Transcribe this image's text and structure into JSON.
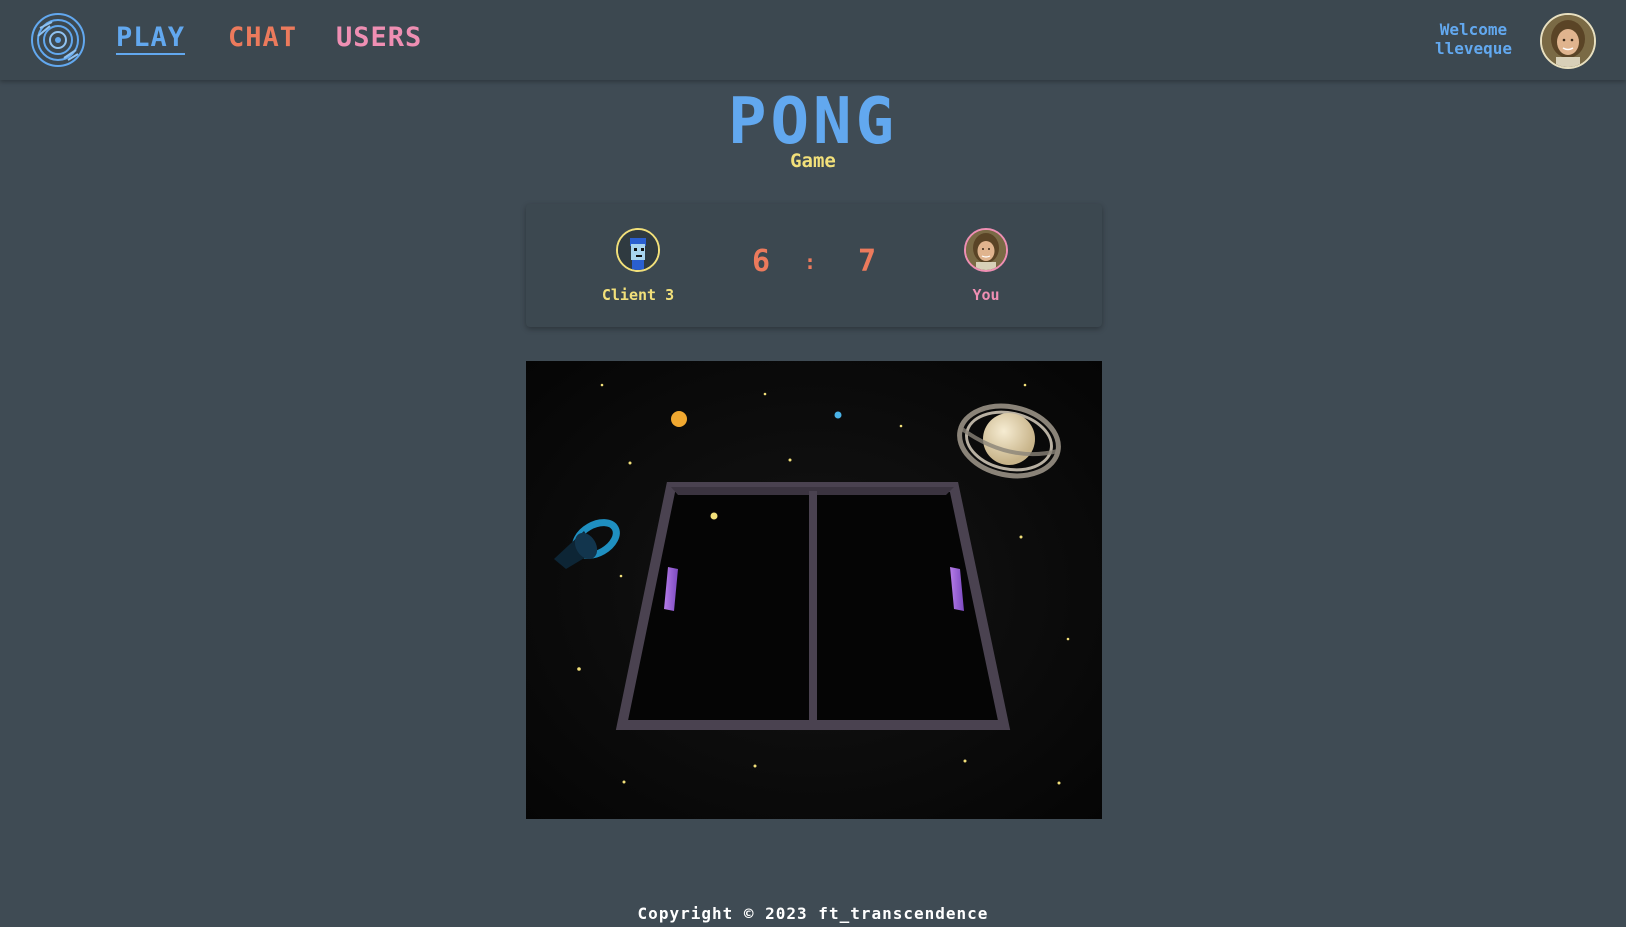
{
  "nav": {
    "links": [
      {
        "label": "PLAY",
        "color": "#62a8ef",
        "active": true
      },
      {
        "label": "CHAT",
        "color": "#ec7a5c",
        "active": false
      },
      {
        "label": "USERS",
        "color": "#ef8fb3",
        "active": false
      }
    ],
    "welcome_line1": "Welcome",
    "welcome_line2": "lleveque",
    "logo_icon": "vinyl-disc-logo-icon",
    "avatar_icon": "user-avatar"
  },
  "header": {
    "title": "PONG",
    "subtitle": "Game"
  },
  "scoreboard": {
    "player1": {
      "name": "Client 3",
      "avatar": "pixel-avatar",
      "color": "#f2e07a"
    },
    "player2": {
      "name": "You",
      "avatar": "user-avatar",
      "color": "#ef8fb3"
    },
    "score_left": "6",
    "separator": ":",
    "score_right": "7"
  },
  "footer": {
    "copyright": "Copyright © 2023 ft_transcendence"
  },
  "colors": {
    "background": "#3f4b54",
    "blue": "#62a8ef",
    "orange": "#ec7a5c",
    "pink": "#ef8fb3",
    "yellow": "#f2e07a"
  }
}
